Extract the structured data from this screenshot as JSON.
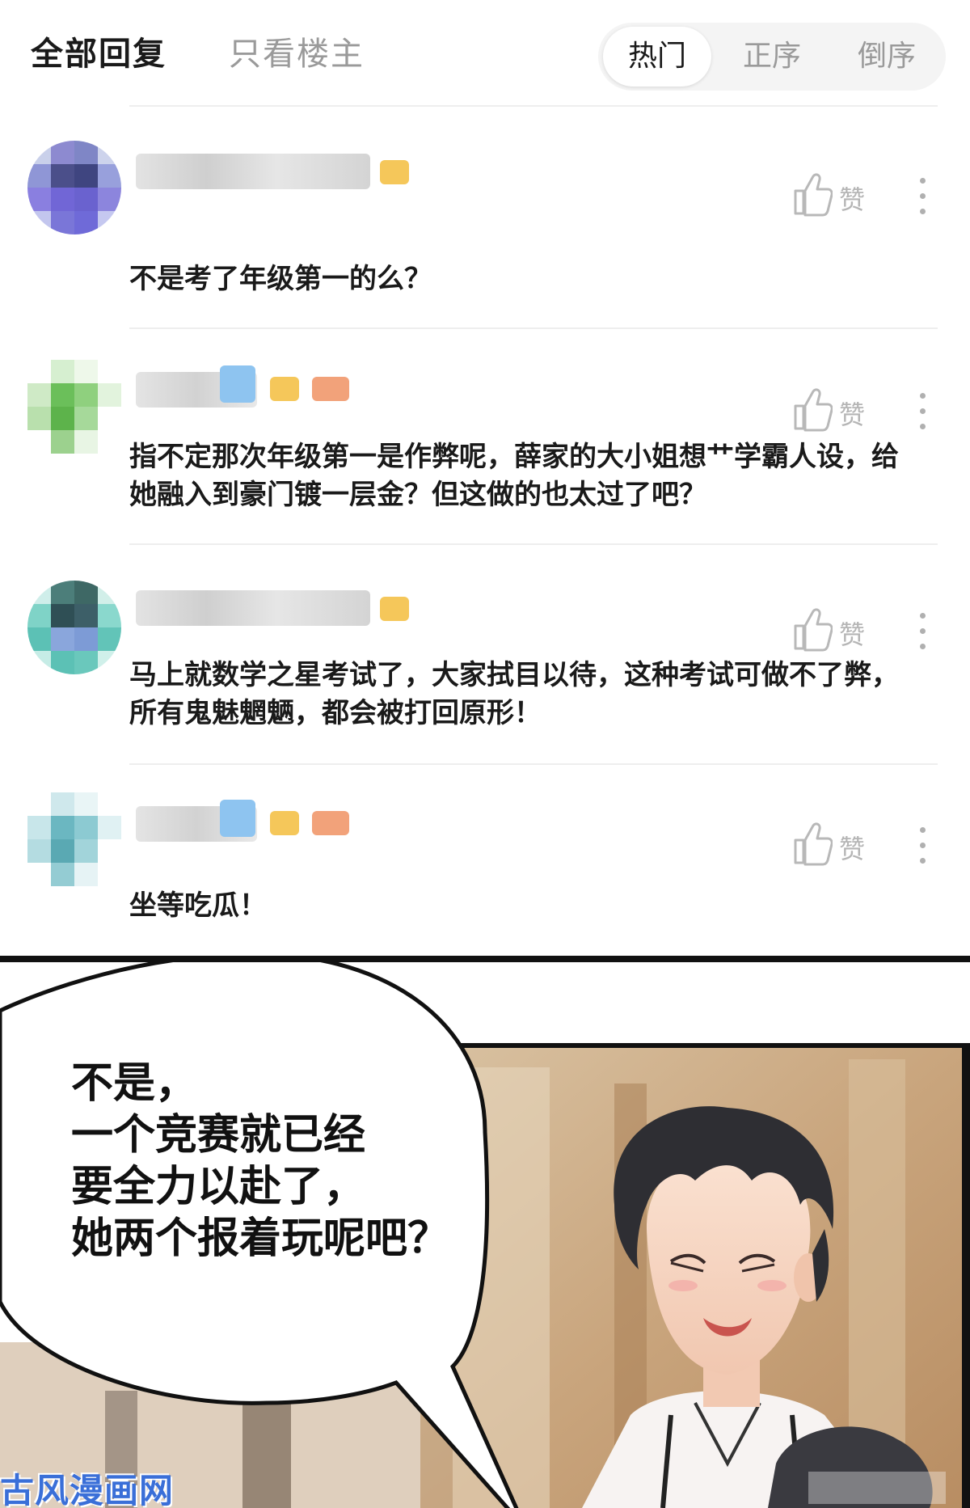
{
  "tabs": {
    "all": "全部回复",
    "owner_only": "只看楼主"
  },
  "sort": {
    "hot": "热门",
    "asc": "正序",
    "desc": "倒序",
    "active": "热门"
  },
  "like_label": "赞",
  "comments": [
    {
      "text": "不是考了年级第一的么？"
    },
    {
      "text": "指不定那次年级第一是作弊呢，薛家的大小姐想艹学霸人设，给她融入到豪门镀一层金？但这做的也太过了吧？"
    },
    {
      "text": "马上就数学之星考试了，大家拭目以待，这种考试可做不了弊，所有鬼魅魍魉，都会被打回原形！"
    },
    {
      "text": "坐等吃瓜！"
    }
  ],
  "speech_bubble": {
    "lines": [
      "不是，",
      "一个竞赛就已经",
      "要全力以赴了，",
      "她两个报着玩呢吧？"
    ]
  },
  "watermark": "古风漫画网",
  "colors": {
    "avatar_1": "#6f6ad8",
    "avatar_2": "#6bbf5a",
    "avatar_3": "#5cc1b5",
    "avatar_4": "#6bb7c1",
    "badge_gold": "#f5c75a",
    "badge_blue": "#8ec4f0",
    "badge_orange": "#f2a27a"
  }
}
